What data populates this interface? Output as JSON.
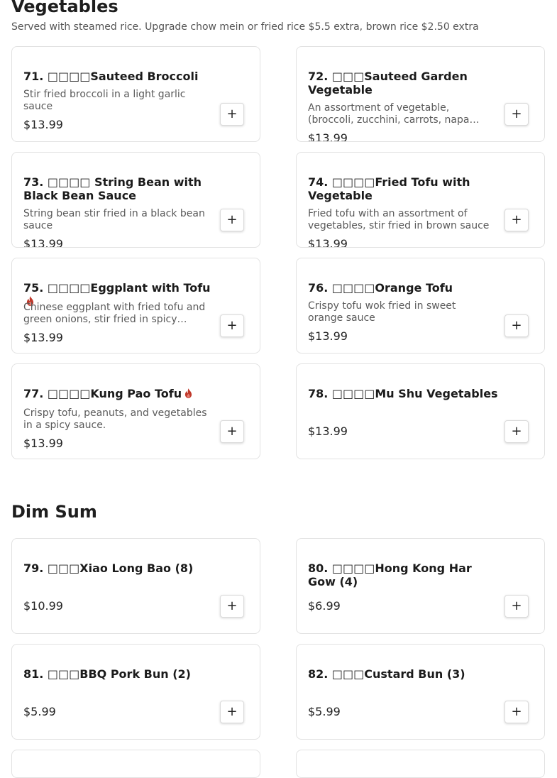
{
  "sections": {
    "vegetables": {
      "title": "Vegetables",
      "subtitle": "Served with steamed rice. Upgrade chow mein or fried rice $5.5 extra, brown rice $2.50 extra",
      "items": [
        {
          "name": "71. □□□□Sauteed Broccoli",
          "description": "Stir fried broccoli in a light garlic sauce",
          "price": "$13.99",
          "add": "+"
        },
        {
          "name": "72. □□□Sauteed Garden Vegetable",
          "description": "An assortment of vegetable, (broccoli, zucchini, carrots, napa…",
          "price": "$13.99",
          "add": "+"
        },
        {
          "name": "73. □□□□ String Bean with Black Bean Sauce",
          "description": "String bean stir fried in a black bean sauce",
          "price": "$13.99",
          "add": "+"
        },
        {
          "name": "74. □□□□Fried Tofu with Vegetable",
          "description": "Fried tofu with an assortment of vegetables, stir fried in brown sauce",
          "price": "$13.99",
          "add": "+"
        },
        {
          "name": "75. □□□□Eggplant with Tofu",
          "description": "Chinese eggplant with fried tofu and green onions, stir fried in spicy…",
          "price": "$13.99",
          "add": "+"
        },
        {
          "name": "76. □□□□Orange Tofu",
          "description": "Crispy tofu wok fried in sweet orange sauce",
          "price": "$13.99",
          "add": "+"
        },
        {
          "name": "77. □□□□Kung Pao Tofu",
          "description": "Crispy tofu, peanuts, and vegetables in a spicy sauce.",
          "price": "$13.99",
          "add": "+"
        },
        {
          "name": "78. □□□□Mu Shu Vegetables",
          "description": "",
          "price": "$13.99",
          "add": "+"
        }
      ]
    },
    "dim_sum": {
      "title": "Dim Sum",
      "items": [
        {
          "name": "79. □□□Xiao Long Bao (8)",
          "price": "$10.99",
          "add": "+"
        },
        {
          "name": "80. □□□□Hong Kong Har Gow (4)",
          "price": "$6.99",
          "add": "+"
        },
        {
          "name": "81. □□□BBQ Pork Bun (2)",
          "price": "$5.99",
          "add": "+"
        },
        {
          "name": "82. □□□Custard Bun (3)",
          "price": "$5.99",
          "add": "+"
        }
      ]
    }
  },
  "icons": {
    "spicy": "flame-icon",
    "add": "plus-icon"
  },
  "colors": {
    "spicy": "#c0392b",
    "border": "#e2e2e2"
  }
}
